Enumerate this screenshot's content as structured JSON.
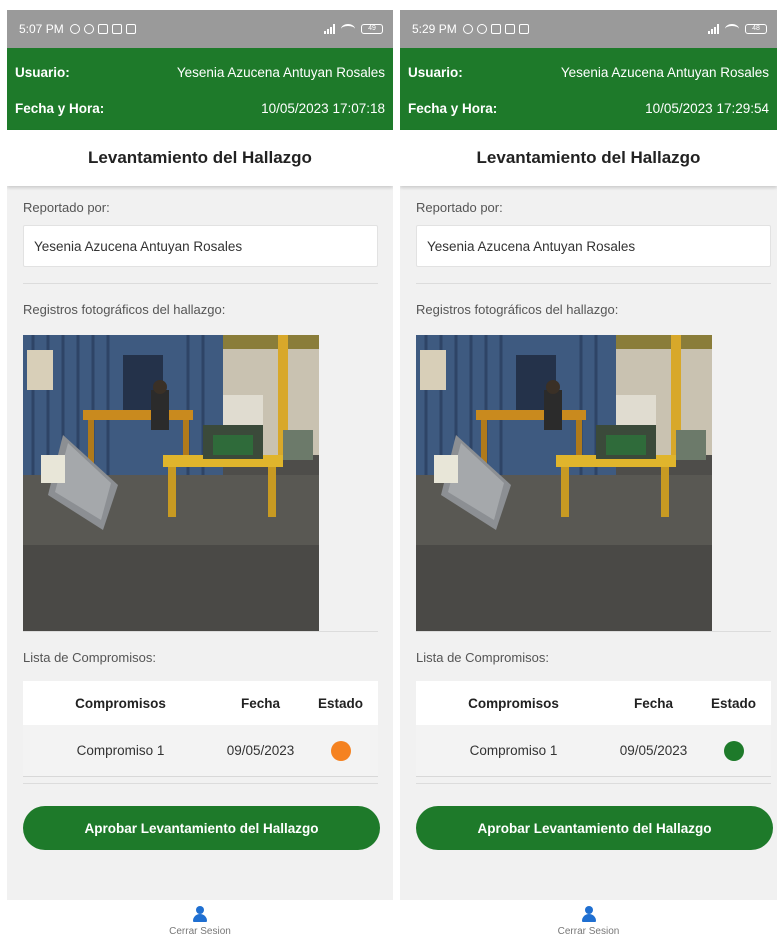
{
  "screens": [
    {
      "status_time": "5:07 PM",
      "battery": "49",
      "user_label": "Usuario:",
      "user_value": "Yesenia Azucena Antuyan Rosales",
      "datetime_label": "Fecha y Hora:",
      "datetime_value": "10/05/2023 17:07:18",
      "title": "Levantamiento del Hallazgo",
      "reported_label": "Reportado por:",
      "reported_value": "Yesenia Azucena Antuyan Rosales",
      "photos_label": "Registros fotográficos del hallazgo:",
      "list_label": "Lista de Compromisos:",
      "table_headers": [
        "Compromisos",
        "Fecha",
        "Estado"
      ],
      "rows": [
        {
          "name": "Compromiso 1",
          "date": "09/05/2023",
          "status_color": "#f58220"
        }
      ],
      "approve_button": "Aprobar Levantamiento del Hallazgo",
      "logout_label": "Cerrar Sesion"
    },
    {
      "status_time": "5:29 PM",
      "battery": "48",
      "user_label": "Usuario:",
      "user_value": "Yesenia Azucena Antuyan Rosales",
      "datetime_label": "Fecha y Hora:",
      "datetime_value": "10/05/2023 17:29:54",
      "title": "Levantamiento del Hallazgo",
      "reported_label": "Reportado por:",
      "reported_value": "Yesenia Azucena Antuyan Rosales",
      "photos_label": "Registros fotográficos del hallazgo:",
      "list_label": "Lista de Compromisos:",
      "table_headers": [
        "Compromisos",
        "Fecha",
        "Estado"
      ],
      "rows": [
        {
          "name": "Compromiso 1",
          "date": "09/05/2023",
          "status_color": "#1e7a2a"
        }
      ],
      "approve_button": "Aprobar Levantamiento del Hallazgo",
      "logout_label": "Cerrar Sesion"
    }
  ],
  "colors": {
    "header_green": "#1e7a2a",
    "status_bar_gray": "#9a9a9a",
    "user_icon_blue": "#1f6fd1"
  }
}
